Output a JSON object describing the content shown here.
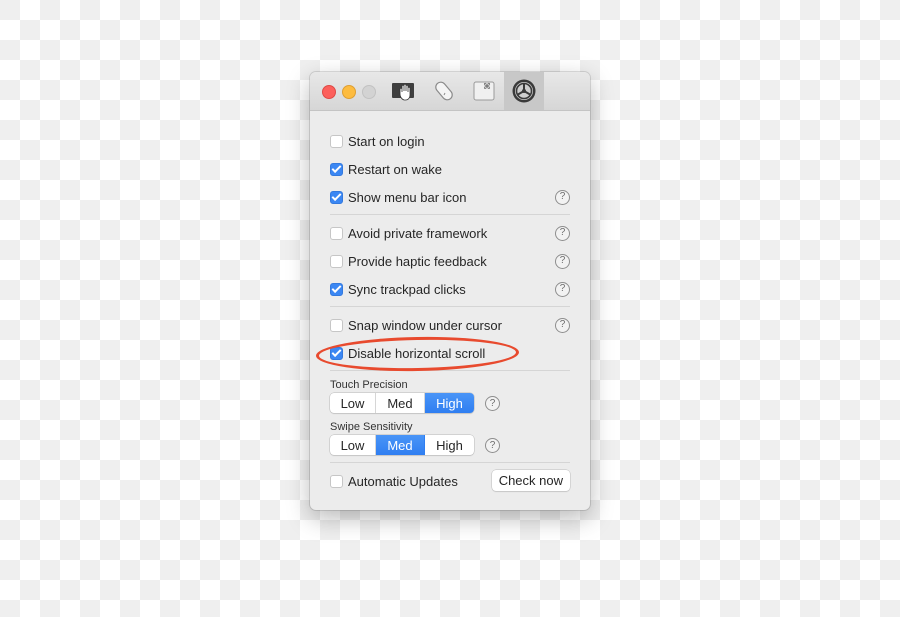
{
  "window": {
    "toolbar_tabs": [
      {
        "icon": "gesture-hand-icon",
        "label": "Gestures",
        "active": false
      },
      {
        "icon": "mouse-icon",
        "label": "Mouse",
        "active": false
      },
      {
        "icon": "keyboard-shortcut-icon",
        "label": "Shortcuts",
        "active": false
      },
      {
        "icon": "gear-icon",
        "label": "General",
        "active": true
      }
    ]
  },
  "settings": {
    "group1": [
      {
        "label": "Start on login",
        "checked": false,
        "help": false
      },
      {
        "label": "Restart on wake",
        "checked": true,
        "help": false
      },
      {
        "label": "Show menu bar icon",
        "checked": true,
        "help": true
      }
    ],
    "group2": [
      {
        "label": "Avoid private framework",
        "checked": false,
        "help": true
      },
      {
        "label": "Provide haptic feedback",
        "checked": false,
        "help": true
      },
      {
        "label": "Sync trackpad clicks",
        "checked": true,
        "help": true
      }
    ],
    "group3": [
      {
        "label": "Snap window under cursor",
        "checked": false,
        "help": true
      },
      {
        "label": "Disable horizontal scroll",
        "checked": true,
        "help": false
      }
    ],
    "help_glyph": "?",
    "touch_precision": {
      "label": "Touch Precision",
      "options": [
        "Low",
        "Med",
        "High"
      ],
      "selected": "High"
    },
    "swipe_sensitivity": {
      "label": "Swipe Sensitivity",
      "options": [
        "Low",
        "Med",
        "High"
      ],
      "selected": "Med"
    },
    "automatic_updates": {
      "label": "Automatic Updates",
      "checked": false
    },
    "check_now_label": "Check now"
  },
  "annotation": {
    "target": "Disable horizontal scroll",
    "color": "#e84a2e"
  },
  "colors": {
    "accent": "#3b87f3",
    "close": "#fc605c",
    "minimize": "#fdbc40",
    "zoom": "#d3d3d3"
  }
}
